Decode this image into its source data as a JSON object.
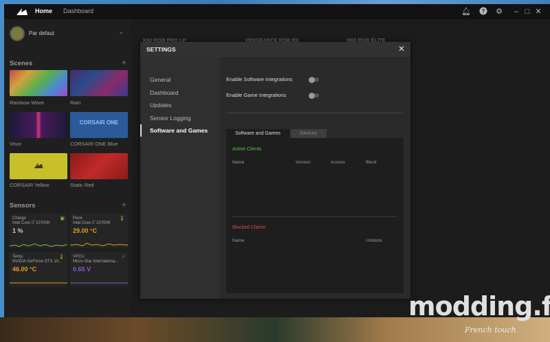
{
  "topbar": {
    "nav": {
      "home": "Home",
      "dashboard": "Dashboard"
    },
    "icons": [
      "bell-icon",
      "help-icon",
      "gear-icon",
      "minimize-icon",
      "maximize-icon",
      "close-icon"
    ]
  },
  "sidebar": {
    "profile": {
      "name": "Par defaut"
    },
    "scenes_title": "Scenes",
    "scenes": [
      {
        "label": "Rainbow Wave"
      },
      {
        "label": "Rain"
      },
      {
        "label": "Visor"
      },
      {
        "label": "CORSAIR ONE Blue",
        "tile_text": "CORSAIR ONE"
      },
      {
        "label": "CORSAIR Yellow"
      },
      {
        "label": "Static Red"
      }
    ],
    "sensors_title": "Sensors",
    "sensors": [
      {
        "title": "Charge",
        "device": "Intel Core i7 10700K",
        "value": "1",
        "unit": "%",
        "color": "#7dc34a"
      },
      {
        "title": "Puce",
        "device": "Intel Core i7 10700K",
        "value": "29.00",
        "unit": "°C",
        "color": "#e0a020"
      },
      {
        "title": "Temp.",
        "device": "NVIDIA GeForce GTX 10...",
        "value": "46.00",
        "unit": "°C",
        "color": "#e0a020"
      },
      {
        "title": "VPCU",
        "device": "Micro-Star Internationa...",
        "value": "0.65",
        "unit": "V",
        "color": "#8a5ad0"
      }
    ]
  },
  "devices": [
    "K60 RGB PRO LP",
    "VENGEANCE RGB RS",
    "M65 RGB ELITE"
  ],
  "modal": {
    "title": "SETTINGS",
    "nav": [
      "General",
      "Dashboard",
      "Updates",
      "Sensor Logging",
      "Software and Games"
    ],
    "active_nav": "Software and Games",
    "options": [
      {
        "label": "Enable Software Integrations",
        "enabled": false
      },
      {
        "label": "Enable Game Integrations",
        "enabled": false
      }
    ],
    "tabs": [
      "Software and Games",
      "Devices"
    ],
    "active_clients": {
      "title": "Active Clients",
      "columns": [
        "Name",
        "Version",
        "Access",
        "Block"
      ]
    },
    "blocked_clients": {
      "title": "Blocked Clients",
      "columns": [
        "Name",
        "Unblock"
      ]
    }
  },
  "watermark": {
    "main": "modding.fr",
    "sub": "French touch"
  },
  "colors": {
    "active_green": "#5ec24a",
    "blocked_red": "#d94a4a"
  }
}
